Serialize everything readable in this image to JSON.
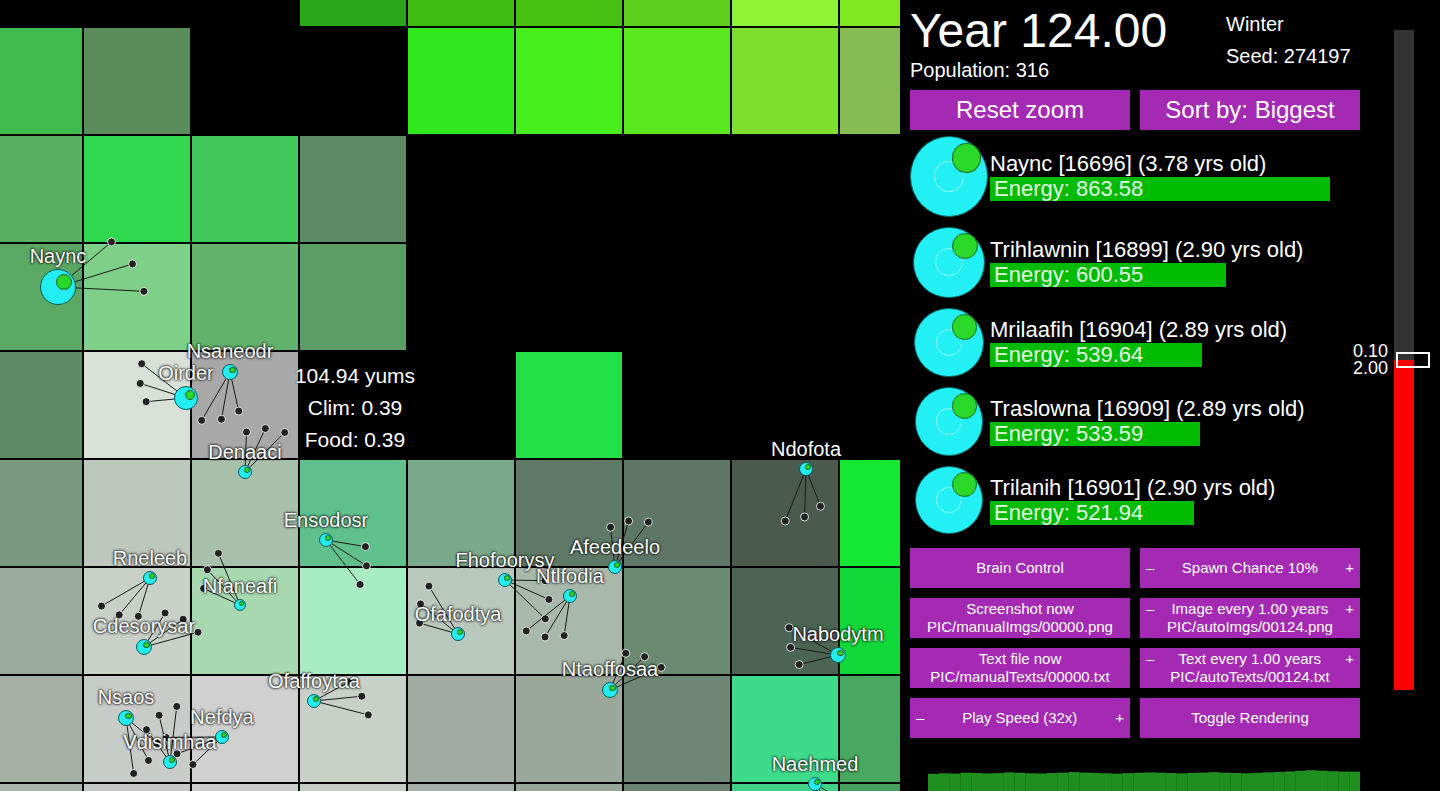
{
  "map": {
    "tiles": [
      [
        "#000000",
        "#000000",
        "#000000",
        "#2aa81a",
        "#3ebd10",
        "#47c10f",
        "#5cd01a",
        "#8ff535",
        "#80e820"
      ],
      [
        "#3fba4c",
        "#5a8c5c",
        "#000000",
        "#000000",
        "#30e81c",
        "#46ee1c",
        "#5ae820",
        "#80de2c",
        "#86bc52"
      ],
      [
        "#58b060",
        "#2fd84c",
        "#40c85a",
        "#5e8a64",
        "#000000",
        "#000000",
        "#000000",
        "#000000",
        "#000000"
      ],
      [
        "#5aa864",
        "#7ed088",
        "#62b26c",
        "#5a9e66",
        "#000000",
        "#000000",
        "#000000",
        "#000000",
        "#000000"
      ],
      [
        "#5e8a64",
        "#d8e0d8",
        "#a8a8a8",
        "#000000",
        "#000000",
        "#22e046",
        "#000000",
        "#000000",
        "#000000"
      ],
      [
        "#7a9a80",
        "#bcc8bc",
        "#a8c0aa",
        "#60c08c",
        "#7aa88a",
        "#5e7a66",
        "#5e7666",
        "#4a5a4e",
        "#14e830"
      ],
      [
        "#9aaa9c",
        "#c8d0c8",
        "#a8d8b0",
        "#a8ecc4",
        "#b8c8bc",
        "#a8b8aa",
        "#6a8a72",
        "#4c6454",
        "#10d838"
      ],
      [
        "#a4b0a6",
        "#c8ccc8",
        "#d0d0d0",
        "#c8d0c8",
        "#a0aaa2",
        "#9aa89c",
        "#6e8674",
        "#3edc8a",
        "#48a860"
      ],
      [
        "#a8b4aa",
        "#c4c8c4",
        "#cccccc",
        "#c4ccc4",
        "#a4aea6",
        "#98a69a",
        "#6a8270",
        "#40d088",
        "#44a05c"
      ]
    ]
  },
  "creatures": [
    {
      "name": "Naync"
    },
    {
      "name": "Nsaneodr"
    },
    {
      "name": "Oirder"
    },
    {
      "name": "Denaaci"
    },
    {
      "name": "Ensodosr"
    },
    {
      "name": "Rneleeb"
    },
    {
      "name": "Nfaneafi"
    },
    {
      "name": "Cdesorysar"
    },
    {
      "name": "Nsaos"
    },
    {
      "name": "Nefdya"
    },
    {
      "name": "Vdisimhaa"
    },
    {
      "name": "Ofaffoytaa"
    },
    {
      "name": "Ndofota"
    },
    {
      "name": "Nabodytm"
    },
    {
      "name": "Afeedeelo"
    },
    {
      "name": "Fhofoorysy"
    },
    {
      "name": "Ntlfodia"
    },
    {
      "name": "Ofafodtya"
    },
    {
      "name": "Ntaoffosaa"
    },
    {
      "name": "Naehmed"
    }
  ],
  "tooltip": {
    "lines": [
      "104.94 yums",
      "Clim: 0.39",
      "Food: 0.39"
    ]
  },
  "header": {
    "year": "Year 124.00",
    "season": "Winter",
    "seed": "Seed: 274197",
    "population": "Population: 316"
  },
  "top_buttons": [
    "Reset zoom",
    "Sort by: Biggest"
  ],
  "leaderboard": [
    {
      "name": "Naync [16696] (3.78 yrs old)",
      "energy": "Energy: 863.58",
      "level": 0.85
    },
    {
      "name": "Trihlawnin [16899] (2.90 yrs old)",
      "energy": "Energy: 600.55",
      "level": 0.59
    },
    {
      "name": "Mrilaafih [16904] (2.89 yrs old)",
      "energy": "Energy: 539.64",
      "level": 0.53
    },
    {
      "name": "Traslowna [16909] (2.89 yrs old)",
      "energy": "Energy: 533.59",
      "level": 0.525
    },
    {
      "name": "Trilanih [16901] (2.90 yrs old)",
      "energy": "Energy: 521.94",
      "level": 0.51
    }
  ],
  "controls": [
    {
      "kind": "button",
      "lines": [
        "Brain Control"
      ]
    },
    {
      "kind": "stepper",
      "minus": "–",
      "label": "Spawn Chance 10%",
      "plus": "+"
    },
    {
      "kind": "button",
      "lines": [
        "Screenshot now",
        "PIC/manualImgs/00000.png"
      ]
    },
    {
      "kind": "stepper",
      "minus": "–",
      "label": "Image every 1.00 years",
      "plus": "+",
      "sub": "PIC/autoImgs/00124.png"
    },
    {
      "kind": "button",
      "lines": [
        "Text file now",
        "PIC/manualTexts/00000.txt"
      ]
    },
    {
      "kind": "stepper",
      "minus": "–",
      "label": "Text every 1.00 years",
      "plus": "+",
      "sub": "PIC/autoTexts/00124.txt"
    },
    {
      "kind": "stepper",
      "minus": "–",
      "label": "Play Speed (32x)",
      "plus": "+"
    },
    {
      "kind": "button",
      "lines": [
        "Toggle Rendering"
      ]
    }
  ],
  "speed_slider": {
    "level": 0.5,
    "labels": [
      "0.10",
      "2.00"
    ]
  },
  "population_chart": {
    "values": [
      280,
      290,
      285,
      300,
      295,
      288,
      292,
      305,
      298,
      290,
      286,
      294,
      300,
      310,
      302,
      296,
      290,
      284,
      292,
      298,
      304,
      300,
      294,
      288,
      296,
      302,
      308,
      300,
      295,
      290,
      298,
      306,
      312,
      320,
      330,
      340,
      332,
      324,
      318,
      316
    ]
  }
}
